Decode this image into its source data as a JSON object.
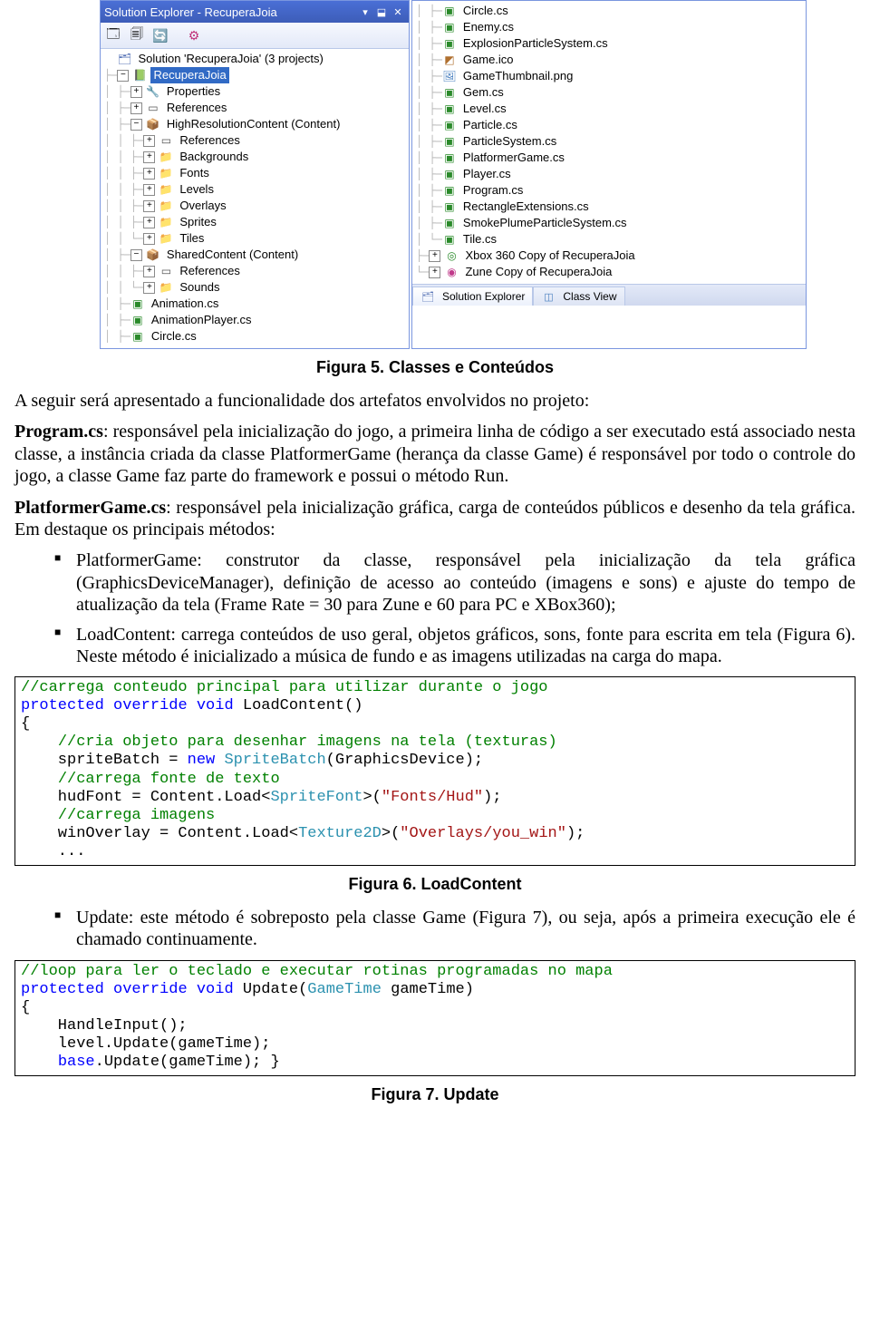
{
  "solution_explorer": {
    "titlebar": "Solution Explorer - RecuperaJoia",
    "root": "Solution 'RecuperaJoia' (3 projects)",
    "project": "RecuperaJoia",
    "left_nodes": {
      "properties": "Properties",
      "references": "References",
      "hires": "HighResolutionContent (Content)",
      "hires_children": {
        "references": "References",
        "backgrounds": "Backgrounds",
        "fonts": "Fonts",
        "levels": "Levels",
        "overlays": "Overlays",
        "sprites": "Sprites",
        "tiles": "Tiles"
      },
      "shared": "SharedContent (Content)",
      "shared_children": {
        "references": "References",
        "sounds": "Sounds"
      },
      "animation": "Animation.cs",
      "animationplayer": "AnimationPlayer.cs",
      "circle": "Circle.cs"
    },
    "right_nodes": {
      "circle": "Circle.cs",
      "enemy": "Enemy.cs",
      "eps": "ExplosionParticleSystem.cs",
      "gameico": "Game.ico",
      "thumb": "GameThumbnail.png",
      "gem": "Gem.cs",
      "level": "Level.cs",
      "particle": "Particle.cs",
      "psystem": "ParticleSystem.cs",
      "platformer": "PlatformerGame.cs",
      "player": "Player.cs",
      "program": "Program.cs",
      "rect": "RectangleExtensions.cs",
      "smoke": "SmokePlumeParticleSystem.cs",
      "tile": "Tile.cs",
      "xbox": "Xbox 360 Copy of RecuperaJoia",
      "zune": "Zune Copy of RecuperaJoia"
    },
    "bottom_tabs": {
      "se": "Solution Explorer",
      "cv": "Class View"
    }
  },
  "captions": {
    "fig5": "Figura 5. Classes e Conteúdos",
    "fig6": "Figura 6. LoadContent",
    "fig7": "Figura 7. Update"
  },
  "text": {
    "intro": "A seguir será apresentado a funcionalidade dos artefatos envolvidos no projeto:",
    "program_term": "Program.cs",
    "program_rest": ": responsável pela inicialização do jogo, a primeira linha de código a ser executado está associado nesta classe, a instância criada da classe PlatformerGame (herança da classe Game) é responsável por todo o controle do jogo, a classe Game faz parte do framework e possui o método Run.",
    "platformer_term": "PlatformerGame.cs",
    "platformer_rest": ": responsável pela inicialização gráfica, carga de conteúdos públicos e desenho da tela gráfica. Em destaque os principais métodos:",
    "b1": "PlatformerGame: construtor da classe, responsável pela inicialização da tela gráfica (GraphicsDeviceManager), definição de acesso ao conteúdo (imagens e sons)  e ajuste do tempo de atualização da tela (Frame Rate = 30 para Zune e 60 para PC e XBox360);",
    "b2": "LoadContent: carrega conteúdos de uso geral, objetos gráficos, sons, fonte para escrita em tela (Figura 6). Neste método é inicializado a música de fundo e as imagens utilizadas na carga do mapa.",
    "b3": "Update: este método é sobreposto pela classe Game (Figura 7), ou seja, após a primeira execução ele é chamado continuamente."
  }
}
